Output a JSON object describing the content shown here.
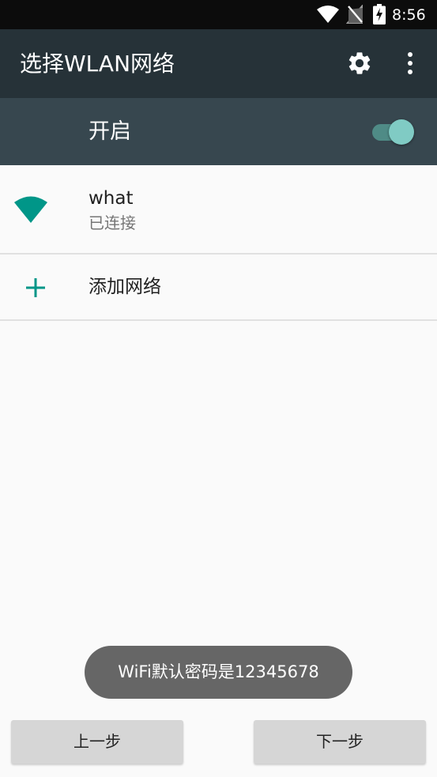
{
  "status_bar": {
    "time": "8:56",
    "icons": [
      "wifi-icon",
      "no-sim-signal-icon",
      "battery-charging-icon"
    ]
  },
  "toolbar": {
    "title": "选择WLAN网络",
    "icons": [
      "gear-icon",
      "more-vert-icon"
    ]
  },
  "wlan_switch": {
    "label": "开启",
    "state": "on"
  },
  "networks": [
    {
      "name": "what",
      "status": "已连接",
      "icon": "wifi-signal-icon"
    }
  ],
  "add_network": {
    "label": "添加网络",
    "icon": "plus-icon"
  },
  "toast": {
    "message": "WiFi默认密码是12345678"
  },
  "buttons": {
    "prev": "上一步",
    "next": "下一步"
  },
  "colors": {
    "status_bar": "#0c0c0c",
    "toolbar": "#263238",
    "switch_bar": "#37474f",
    "accent": "#009688",
    "switch_thumb": "#80cbc4",
    "background": "#fafafa"
  }
}
